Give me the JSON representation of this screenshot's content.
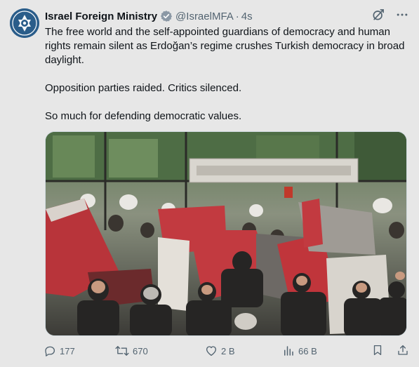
{
  "author": {
    "display_name": "Israel Foreign Ministry",
    "handle": "@IsraelMFA",
    "separator": "·",
    "time": "4s",
    "verified": true,
    "verified_color": "#8b98a5"
  },
  "tweet": {
    "paragraphs": [
      "The free world and the self-appointed guardians of democracy and human rights remain silent as Erdoğan’s regime crushes Turkish democracy in broad daylight.",
      "Opposition parties raided. Critics silenced.",
      "So much for defending democratic values."
    ]
  },
  "media": {
    "type": "photo"
  },
  "stats": {
    "replies": "177",
    "retweets": "670",
    "likes": "2 B",
    "views": "66 B"
  },
  "icons": {
    "header": [
      "grok-icon",
      "more-icon"
    ],
    "actions": [
      "reply-icon",
      "retweet-icon",
      "like-icon",
      "views-icon",
      "bookmark-icon",
      "share-icon"
    ]
  },
  "colors": {
    "background": "#e7e7e7",
    "text": "#0f1419",
    "muted": "#536471",
    "retweet": "#536471"
  }
}
